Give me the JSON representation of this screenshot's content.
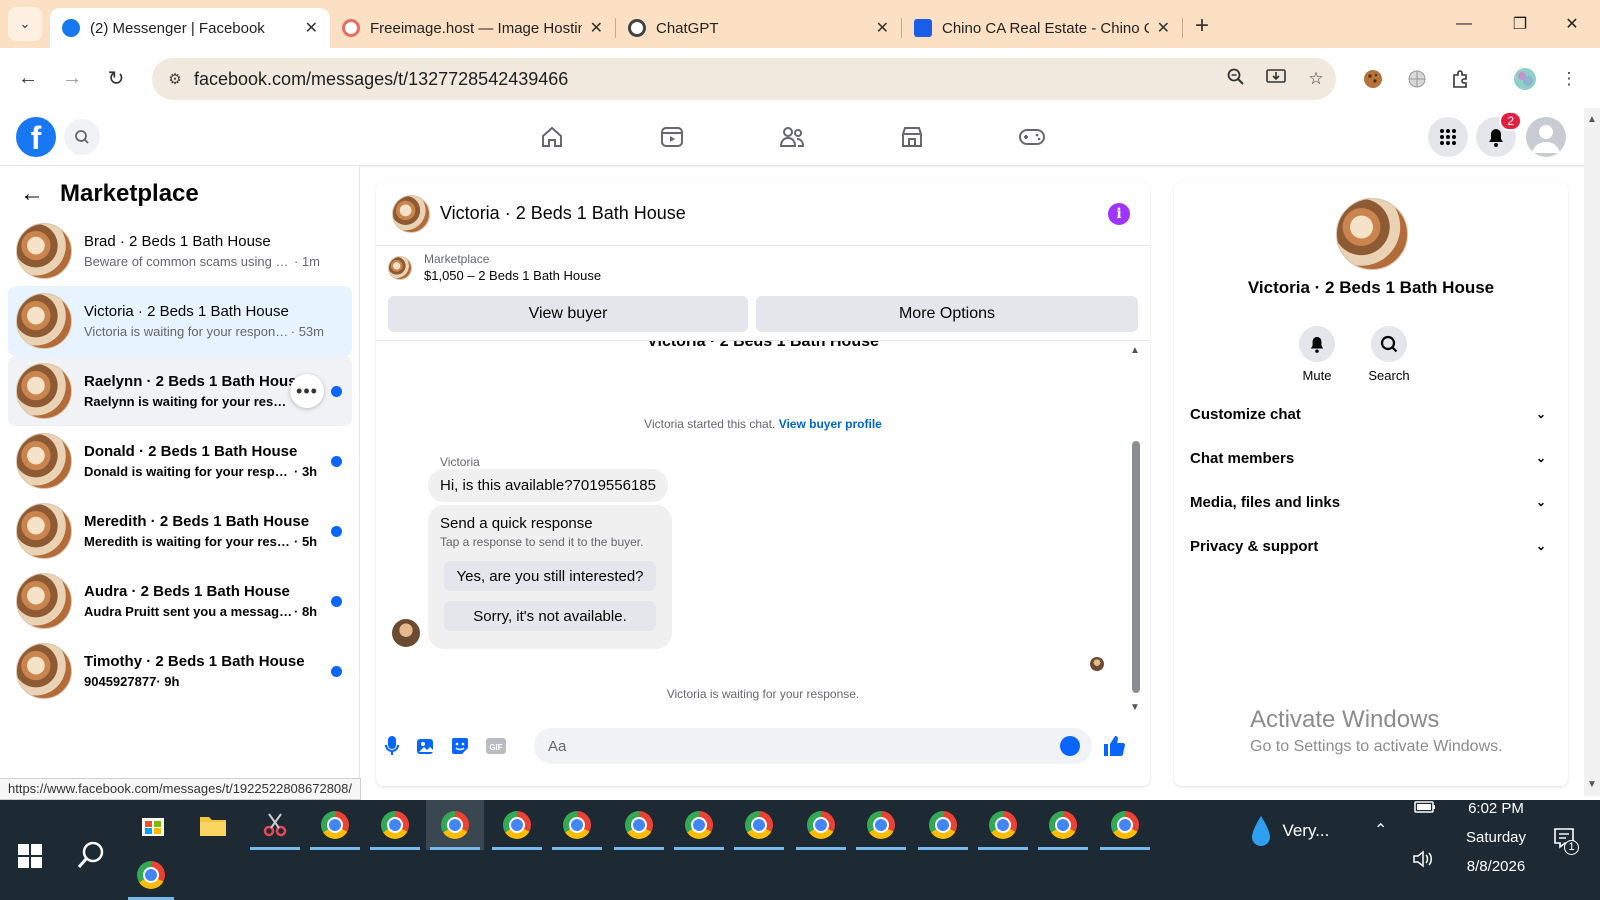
{
  "browser": {
    "tabs": [
      {
        "title": "(2) Messenger | Facebook",
        "favicon_color": "#1877f2",
        "active": true
      },
      {
        "title": "Freeimage.host — Image Hostin",
        "favicon_color": "#e86c5f",
        "active": false
      },
      {
        "title": "ChatGPT",
        "favicon_color": "#444444",
        "active": false
      },
      {
        "title": "Chino CA Real Estate - Chino CA",
        "favicon_color": "#1a5ee8",
        "active": false
      }
    ],
    "url": "facebook.com/messages/t/1327728542439466",
    "status_url": "https://www.facebook.com/messages/t/1922522808672808/"
  },
  "fb": {
    "notification_count": "2"
  },
  "sidebar": {
    "title": "Marketplace",
    "chats": [
      {
        "name": "Brad · 2 Beds 1 Bath House",
        "preview": "Beware of common scams using pay...",
        "time": "· 1m",
        "unread": false,
        "selected": false
      },
      {
        "name": "Victoria · 2 Beds 1 Bath House",
        "preview": "Victoria is waiting for your response.",
        "time": "· 53m",
        "unread": false,
        "selected": true
      },
      {
        "name": "Raelynn · 2 Beds 1 Bath House",
        "preview": "Raelynn is waiting for your respon...",
        "time": "",
        "unread": true,
        "selected": false
      },
      {
        "name": "Donald · 2 Beds 1 Bath House",
        "preview": "Donald is waiting for your response.",
        "time": "· 3h",
        "unread": true,
        "selected": false
      },
      {
        "name": "Meredith · 2 Beds 1 Bath House",
        "preview": "Meredith is waiting for your respo...",
        "time": "· 5h",
        "unread": true,
        "selected": false
      },
      {
        "name": "Audra · 2 Beds 1 Bath House",
        "preview": "Audra Pruitt sent you a message a...",
        "time": "· 8h",
        "unread": true,
        "selected": false
      },
      {
        "name": "Timothy · 2 Beds 1 Bath House",
        "preview": "9045927877",
        "time": "· 9h",
        "unread": true,
        "selected": false
      }
    ]
  },
  "conversation": {
    "title": "Victoria · 2 Beds 1 Bath House",
    "listing_source": "Marketplace",
    "listing_title": "$1,050 – 2 Beds 1 Bath House",
    "view_buyer_label": "View buyer",
    "more_options_label": "More Options",
    "cut_title": "Victoria · 2 Beds 1 Bath House",
    "started_text": "Victoria started this chat.",
    "view_profile_link": "View buyer profile",
    "sender": "Victoria",
    "message": "Hi, is this available?7019556185",
    "quick_response_title": "Send a quick response",
    "quick_response_sub": "Tap a response to send it to the buyer.",
    "quick_responses": [
      "Yes, are you still interested?",
      "Sorry, it's not available."
    ],
    "waiting_text": "Victoria is waiting for your response.",
    "composer_placeholder": "Aa"
  },
  "details": {
    "name": "Victoria · 2 Beds 1 Bath House",
    "actions": [
      {
        "label": "Mute",
        "icon": "bell-icon"
      },
      {
        "label": "Search",
        "icon": "search-icon"
      }
    ],
    "sections": [
      "Customize chat",
      "Chat members",
      "Media, files and links",
      "Privacy & support"
    ]
  },
  "watermark": {
    "line1": "Activate Windows",
    "line2": "Go to Settings to activate Windows."
  },
  "taskbar": {
    "weather": "Very...",
    "time": "6:02 PM",
    "day": "Saturday",
    "date": "8/8/2026",
    "notifications": "1"
  },
  "colors": {
    "fb_blue": "#1877f2",
    "messenger_accent": "#0866ff",
    "unread_dot": "#0866ff",
    "info_purple": "#a033ff",
    "tabbar": "#fbe0c3"
  }
}
